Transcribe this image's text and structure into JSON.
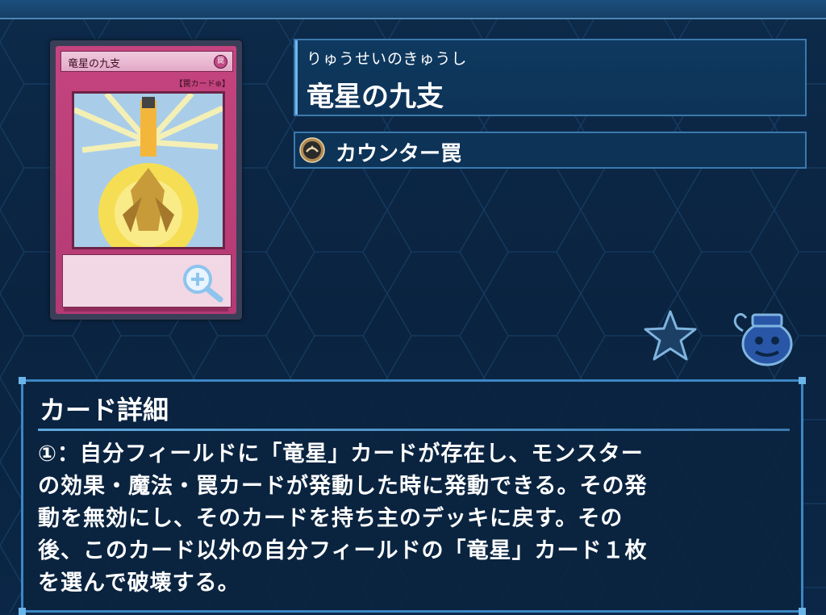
{
  "card": {
    "name_small": "竜星の九支",
    "icon_glyph": "罠",
    "type_line": "【罠カード⊕】"
  },
  "header": {
    "ruby": "りゅうせいのきゅうし",
    "name": "竜星の九支"
  },
  "type": {
    "label": "カウンター罠"
  },
  "actions": {
    "favorite_icon": "star-icon",
    "deck_icon": "pot-icon"
  },
  "detail": {
    "title": "カード詳細",
    "lines": [
      "①：自分フィールドに「竜星」カードが存在し、モンスター",
      "の効果・魔法・罠カードが発動した時に発動できる。その発",
      "動を無効にし、そのカードを持ち主のデッキに戻す。その",
      "後、このカード以外の自分フィールドの「竜星」カード１枚",
      "を選んで破壊する。"
    ]
  },
  "colors": {
    "background": "#0b2646",
    "panel_border": "#3c87c4",
    "trap_card": "#b33a74"
  }
}
